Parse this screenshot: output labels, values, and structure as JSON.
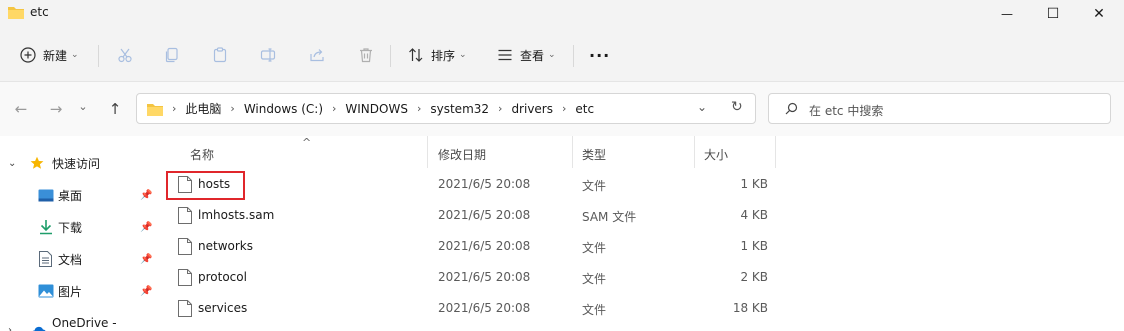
{
  "window": {
    "title": "etc",
    "minimize_glyph": "—",
    "maximize_glyph": "☐",
    "close_glyph": "✕"
  },
  "toolbar": {
    "new_label": "新建",
    "sort_label": "排序",
    "view_label": "查看",
    "more_glyph": "···",
    "icons": [
      "plus-circle-icon",
      "cut-icon",
      "copy-icon",
      "paste-icon",
      "rename-icon",
      "share-icon",
      "delete-icon",
      "sort-icon",
      "view-icon",
      "more-icon"
    ]
  },
  "navigation": {
    "back_glyph": "←",
    "forward_glyph": "→",
    "recent_glyph": "⌄",
    "up_glyph": "↑",
    "breadcrumbs": [
      "此电脑",
      "Windows (C:)",
      "WINDOWS",
      "system32",
      "drivers",
      "etc"
    ],
    "breadcrumb_separator": "›",
    "search_placeholder": "在 etc 中搜索"
  },
  "sidebar": {
    "quick_access_label": "快速访问",
    "items": [
      {
        "label": "桌面",
        "icon": "desktop-icon",
        "pinned": true
      },
      {
        "label": "下载",
        "icon": "download-icon",
        "pinned": true
      },
      {
        "label": "文档",
        "icon": "document-icon",
        "pinned": true
      },
      {
        "label": "图片",
        "icon": "picture-icon",
        "pinned": true
      }
    ],
    "partial_item_label": "OneDrive - Person"
  },
  "columns": {
    "name": "名称",
    "modified": "修改日期",
    "type": "类型",
    "size": "大小",
    "sort_indicator": "^"
  },
  "files": [
    {
      "name": "hosts",
      "modified": "2021/6/5 20:08",
      "type": "文件",
      "size": "1 KB",
      "highlighted": true
    },
    {
      "name": "lmhosts.sam",
      "modified": "2021/6/5 20:08",
      "type": "SAM 文件",
      "size": "4 KB",
      "highlighted": false
    },
    {
      "name": "networks",
      "modified": "2021/6/5 20:08",
      "type": "文件",
      "size": "1 KB",
      "highlighted": false
    },
    {
      "name": "protocol",
      "modified": "2021/6/5 20:08",
      "type": "文件",
      "size": "2 KB",
      "highlighted": false
    },
    {
      "name": "services",
      "modified": "2021/6/5 20:08",
      "type": "文件",
      "size": "18 KB",
      "highlighted": false
    }
  ],
  "colors": {
    "highlight_border": "#e0262b",
    "folder_yellow": "#f4c542",
    "star_yellow": "#f7b500"
  }
}
